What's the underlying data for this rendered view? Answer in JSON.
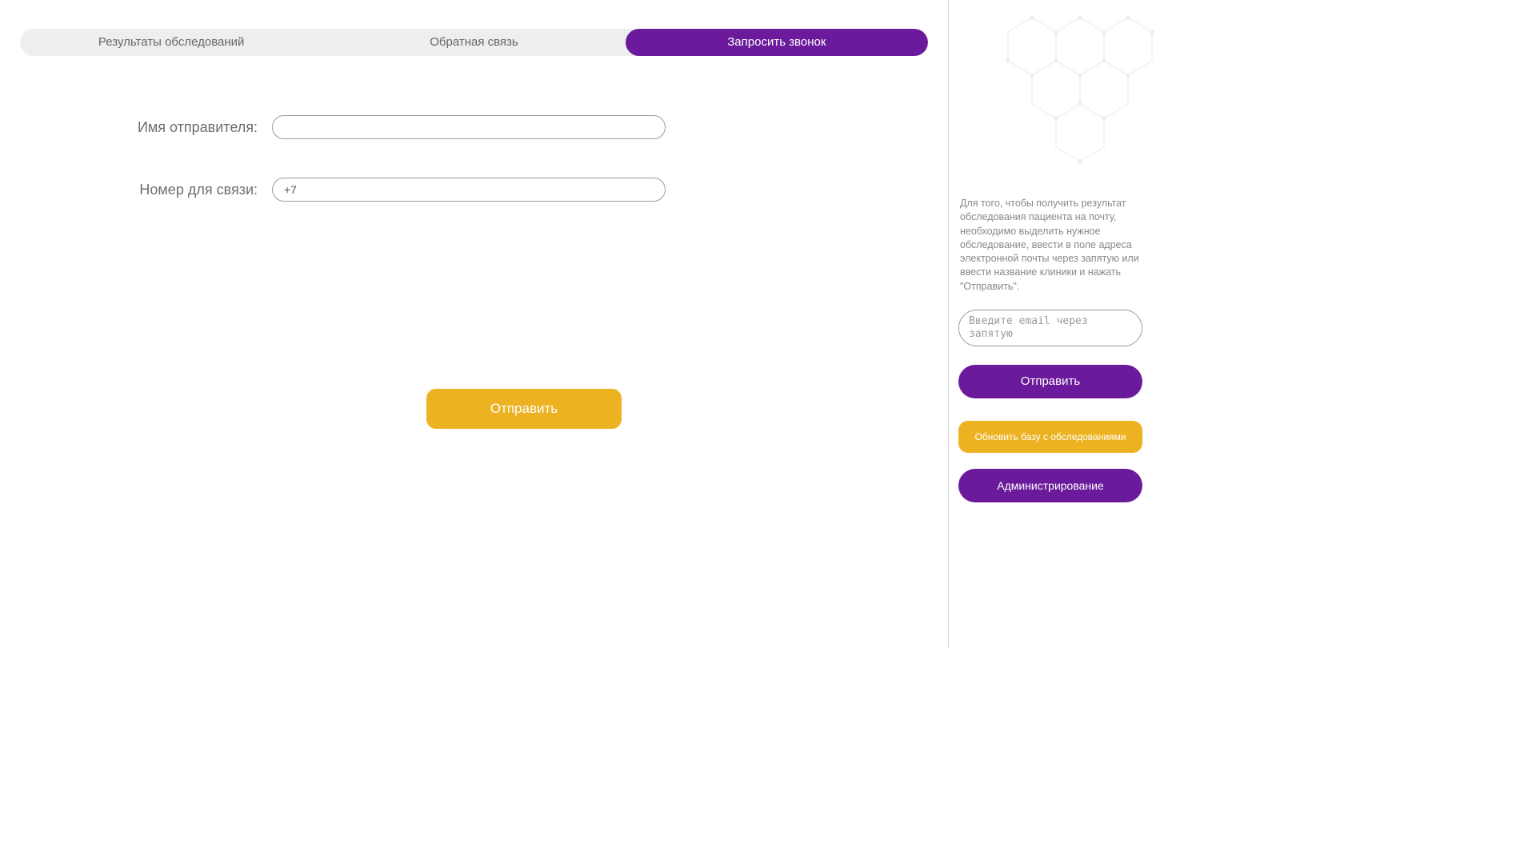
{
  "tabs": [
    {
      "label": "Результаты обследований",
      "active": false
    },
    {
      "label": "Обратная связь",
      "active": false
    },
    {
      "label": "Запросить звонок",
      "active": true
    }
  ],
  "form": {
    "sender_label": "Имя отправителя:",
    "sender_value": "",
    "phone_label": "Номер для связи:",
    "phone_value": "+7",
    "submit_label": "Отправить"
  },
  "sidebar": {
    "help_text": "Для того, чтобы получить результат обследования пациента на почту, необходимо выделить нужное обследование, ввести в поле адреса электронной почты через запятую или ввести название клиники и нажать \"Отправить\".",
    "email_placeholder": "Введите email через запятую",
    "send_label": "Отправить",
    "update_label": "Обновить базу с обследованиями",
    "admin_label": "Администрирование"
  }
}
